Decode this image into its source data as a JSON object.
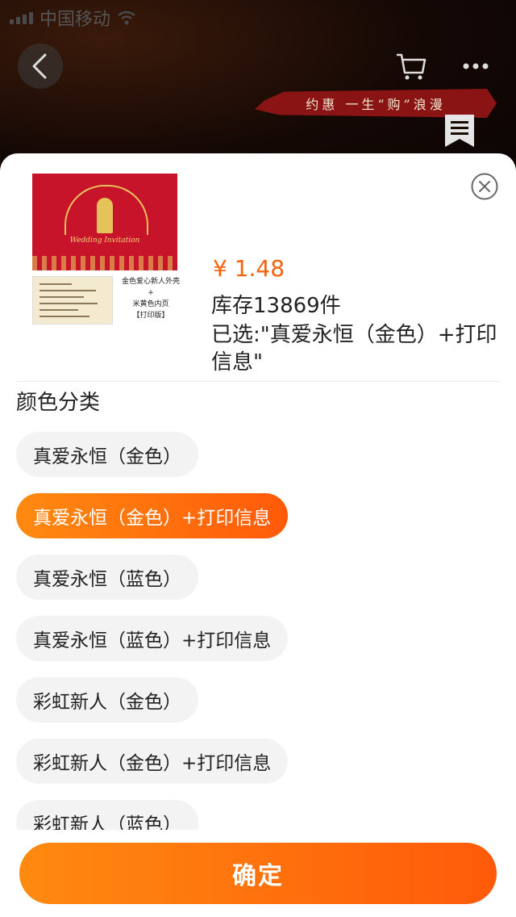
{
  "status_bar": {
    "carrier": "中国移动"
  },
  "banner": {
    "text": "约惠 一生“购”浪漫"
  },
  "product": {
    "invitation_text": "Wedding Invitation",
    "caption": "金色爱心新人外壳\n+\n米黄色内页\n【打印版】",
    "price": "¥ 1.48",
    "stock": "库存13869件",
    "selected": "已选:\"真爱永恒（金色）+打印信息\""
  },
  "section_title": "颜色分类",
  "options": [
    {
      "label": "真爱永恒（金色）",
      "selected": false
    },
    {
      "label": "真爱永恒（金色）+打印信息",
      "selected": true
    },
    {
      "label": "真爱永恒（蓝色）",
      "selected": false
    },
    {
      "label": "真爱永恒（蓝色）+打印信息",
      "selected": false
    },
    {
      "label": "彩虹新人（金色）",
      "selected": false
    },
    {
      "label": "彩虹新人（金色）+打印信息",
      "selected": false
    },
    {
      "label": "彩虹新人（蓝色）",
      "selected": false
    }
  ],
  "confirm_label": "确定",
  "colors": {
    "accent": "#ff6a0a",
    "price": "#f5620a",
    "chip_bg": "#f3f3f3"
  }
}
